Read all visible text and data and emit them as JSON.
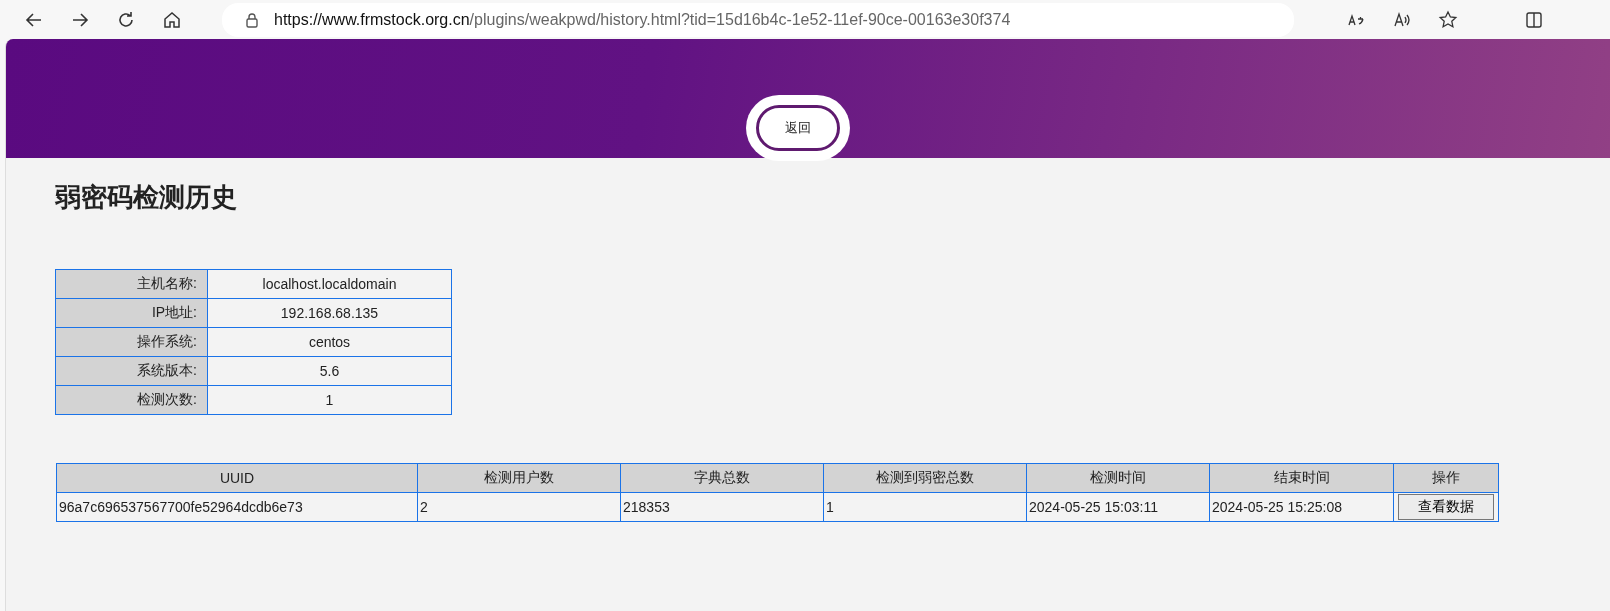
{
  "browser": {
    "url_host": "https://www.frmstock.org.cn",
    "url_path": "/plugins/weakpwd/history.html?tid=15d16b4c-1e52-11ef-90ce-00163e30f374"
  },
  "header": {
    "back_button": "返回"
  },
  "title": "弱密码检测历史",
  "host_info": [
    {
      "label": "主机名称:",
      "value": "localhost.localdomain"
    },
    {
      "label": "IP地址:",
      "value": "192.168.68.135"
    },
    {
      "label": "操作系统:",
      "value": "centos"
    },
    {
      "label": "系统版本:",
      "value": "5.6"
    },
    {
      "label": "检测次数:",
      "value": "1"
    }
  ],
  "history_table": {
    "columns": [
      "UUID",
      "检测用户数",
      "字典总数",
      "检测到弱密总数",
      "检测时间",
      "结束时间",
      "操作"
    ],
    "rows": [
      {
        "cells": [
          "96a7c696537567700fe52964dcdb6e73",
          "2",
          "218353",
          "1",
          "2024-05-25 15:03:11",
          "2024-05-25 15:25:08"
        ],
        "action": "查看数据"
      }
    ]
  }
}
